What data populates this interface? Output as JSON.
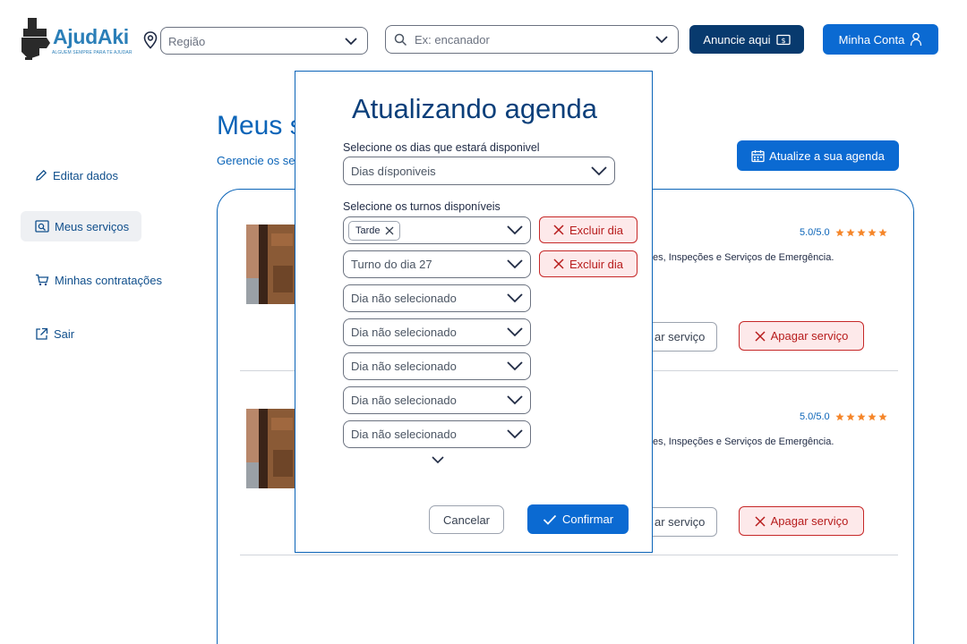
{
  "header": {
    "logo": {
      "name": "AjudAki",
      "tagline": "ALGUEM SEMPRE PARA TE AJUDAR"
    },
    "region": {
      "value": "Região"
    },
    "search": {
      "placeholder": "Ex: encanador"
    },
    "advertise_label": "Anuncie aqui",
    "account_label": "Minha Conta"
  },
  "sidebar": {
    "items": [
      {
        "label": "Editar dados",
        "icon": "pencil-icon",
        "active": false
      },
      {
        "label": "Meus serviços",
        "icon": "search-document-icon",
        "active": true
      },
      {
        "label": "Minhas contratações",
        "icon": "cart-icon",
        "active": false
      },
      {
        "label": "Sair",
        "icon": "external-link-icon",
        "active": false
      }
    ]
  },
  "main": {
    "title": "Meus s",
    "subtitle": "Gerencie os se",
    "update_schedule_label": "Atualize a sua agenda",
    "services": [
      {
        "rating": "5.0/5.0",
        "stars": 5,
        "description": "es, Inspeções e Serviços de Emergência.",
        "edit_label": "ar serviço",
        "delete_label": "Apagar serviço"
      },
      {
        "rating": "5.0/5.0",
        "stars": 5,
        "description": "es, Inspeções e Serviços de Emergência.",
        "edit_label": "ar serviço",
        "delete_label": "Apagar serviço"
      }
    ]
  },
  "modal": {
    "title": "Atualizando agenda",
    "days_label": "Selecione os dias que estará disponivel",
    "days_placeholder": "Dias dísponiveis",
    "shifts_label": "Selecione os turnos disponíveis",
    "shifts": [
      {
        "chip": "Tarde",
        "value": "",
        "delete_label": "Excluir dia"
      },
      {
        "chip": "",
        "value": "Turno do dia 27",
        "delete_label": "Excluir dia"
      },
      {
        "chip": "",
        "value": "Dia não selecionado",
        "delete_label": ""
      },
      {
        "chip": "",
        "value": "Dia não selecionado",
        "delete_label": ""
      },
      {
        "chip": "",
        "value": "Dia não selecionado",
        "delete_label": ""
      },
      {
        "chip": "",
        "value": "Dia não selecionado",
        "delete_label": ""
      },
      {
        "chip": "",
        "value": "Dia não selecionado",
        "delete_label": ""
      }
    ],
    "cancel_label": "Cancelar",
    "confirm_label": "Confirmar"
  },
  "colors": {
    "primary": "#0b6ad2",
    "dark_primary": "#083a6e",
    "title_blue": "#0b3f7a",
    "danger": "#c62828",
    "danger_bg": "#fde9ea",
    "star": "#f5862a"
  }
}
